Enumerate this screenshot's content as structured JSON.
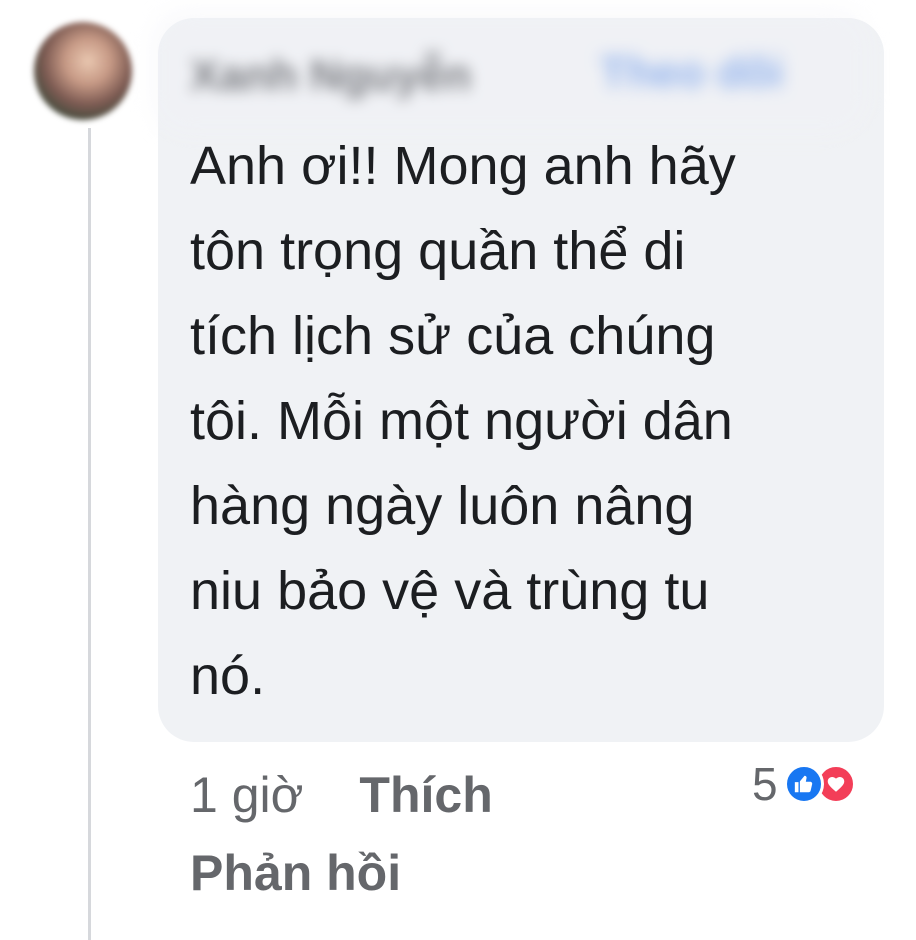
{
  "comment": {
    "author_name": "Xanh Nguyễn",
    "follow_label": "Theo dõi",
    "text": "Anh ơi!! Mong anh hãy\ntôn trọng quần thể di\ntích lịch sử của chúng\ntôi. Mỗi một người dân\nhàng ngày luôn nâng\nniu bảo vệ và trùng tu\nnó.",
    "timestamp": "1 giờ",
    "like_label": "Thích",
    "reply_label": "Phản hồi",
    "reaction_count": "5",
    "reactions": [
      "like-icon",
      "love-icon"
    ]
  },
  "colors": {
    "bubble": "#f0f2f5",
    "text": "#1c1e21",
    "meta": "#65676b",
    "like": "#1877f2",
    "love": "#f33e58"
  }
}
